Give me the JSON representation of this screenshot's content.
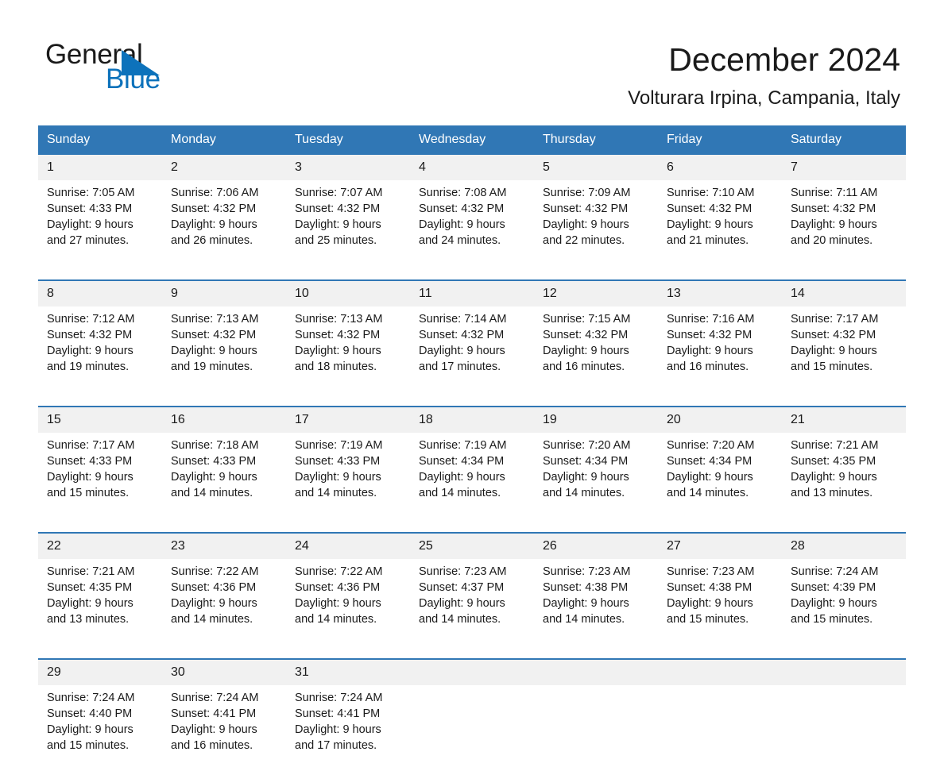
{
  "brand": {
    "name_part1": "General",
    "name_part2": "Blue",
    "triangle_color": "#0d72bb"
  },
  "header": {
    "title": "December 2024",
    "subtitle": "Volturara Irpina, Campania, Italy"
  },
  "colors": {
    "header_blue": "#3077b5",
    "daynum_band": "#f1f1f1",
    "text": "#1a1a1a",
    "brand_blue": "#0d72bb"
  },
  "weekdays": [
    "Sunday",
    "Monday",
    "Tuesday",
    "Wednesday",
    "Thursday",
    "Friday",
    "Saturday"
  ],
  "labels": {
    "sunrise_prefix": "Sunrise:",
    "sunset_prefix": "Sunset:",
    "daylight_prefix": "Daylight:"
  },
  "weeks": [
    [
      {
        "day": "1",
        "sunrise": "Sunrise: 7:05 AM",
        "sunset": "Sunset: 4:33 PM",
        "daylight_line1": "Daylight: 9 hours",
        "daylight_line2": "and 27 minutes."
      },
      {
        "day": "2",
        "sunrise": "Sunrise: 7:06 AM",
        "sunset": "Sunset: 4:32 PM",
        "daylight_line1": "Daylight: 9 hours",
        "daylight_line2": "and 26 minutes."
      },
      {
        "day": "3",
        "sunrise": "Sunrise: 7:07 AM",
        "sunset": "Sunset: 4:32 PM",
        "daylight_line1": "Daylight: 9 hours",
        "daylight_line2": "and 25 minutes."
      },
      {
        "day": "4",
        "sunrise": "Sunrise: 7:08 AM",
        "sunset": "Sunset: 4:32 PM",
        "daylight_line1": "Daylight: 9 hours",
        "daylight_line2": "and 24 minutes."
      },
      {
        "day": "5",
        "sunrise": "Sunrise: 7:09 AM",
        "sunset": "Sunset: 4:32 PM",
        "daylight_line1": "Daylight: 9 hours",
        "daylight_line2": "and 22 minutes."
      },
      {
        "day": "6",
        "sunrise": "Sunrise: 7:10 AM",
        "sunset": "Sunset: 4:32 PM",
        "daylight_line1": "Daylight: 9 hours",
        "daylight_line2": "and 21 minutes."
      },
      {
        "day": "7",
        "sunrise": "Sunrise: 7:11 AM",
        "sunset": "Sunset: 4:32 PM",
        "daylight_line1": "Daylight: 9 hours",
        "daylight_line2": "and 20 minutes."
      }
    ],
    [
      {
        "day": "8",
        "sunrise": "Sunrise: 7:12 AM",
        "sunset": "Sunset: 4:32 PM",
        "daylight_line1": "Daylight: 9 hours",
        "daylight_line2": "and 19 minutes."
      },
      {
        "day": "9",
        "sunrise": "Sunrise: 7:13 AM",
        "sunset": "Sunset: 4:32 PM",
        "daylight_line1": "Daylight: 9 hours",
        "daylight_line2": "and 19 minutes."
      },
      {
        "day": "10",
        "sunrise": "Sunrise: 7:13 AM",
        "sunset": "Sunset: 4:32 PM",
        "daylight_line1": "Daylight: 9 hours",
        "daylight_line2": "and 18 minutes."
      },
      {
        "day": "11",
        "sunrise": "Sunrise: 7:14 AM",
        "sunset": "Sunset: 4:32 PM",
        "daylight_line1": "Daylight: 9 hours",
        "daylight_line2": "and 17 minutes."
      },
      {
        "day": "12",
        "sunrise": "Sunrise: 7:15 AM",
        "sunset": "Sunset: 4:32 PM",
        "daylight_line1": "Daylight: 9 hours",
        "daylight_line2": "and 16 minutes."
      },
      {
        "day": "13",
        "sunrise": "Sunrise: 7:16 AM",
        "sunset": "Sunset: 4:32 PM",
        "daylight_line1": "Daylight: 9 hours",
        "daylight_line2": "and 16 minutes."
      },
      {
        "day": "14",
        "sunrise": "Sunrise: 7:17 AM",
        "sunset": "Sunset: 4:32 PM",
        "daylight_line1": "Daylight: 9 hours",
        "daylight_line2": "and 15 minutes."
      }
    ],
    [
      {
        "day": "15",
        "sunrise": "Sunrise: 7:17 AM",
        "sunset": "Sunset: 4:33 PM",
        "daylight_line1": "Daylight: 9 hours",
        "daylight_line2": "and 15 minutes."
      },
      {
        "day": "16",
        "sunrise": "Sunrise: 7:18 AM",
        "sunset": "Sunset: 4:33 PM",
        "daylight_line1": "Daylight: 9 hours",
        "daylight_line2": "and 14 minutes."
      },
      {
        "day": "17",
        "sunrise": "Sunrise: 7:19 AM",
        "sunset": "Sunset: 4:33 PM",
        "daylight_line1": "Daylight: 9 hours",
        "daylight_line2": "and 14 minutes."
      },
      {
        "day": "18",
        "sunrise": "Sunrise: 7:19 AM",
        "sunset": "Sunset: 4:34 PM",
        "daylight_line1": "Daylight: 9 hours",
        "daylight_line2": "and 14 minutes."
      },
      {
        "day": "19",
        "sunrise": "Sunrise: 7:20 AM",
        "sunset": "Sunset: 4:34 PM",
        "daylight_line1": "Daylight: 9 hours",
        "daylight_line2": "and 14 minutes."
      },
      {
        "day": "20",
        "sunrise": "Sunrise: 7:20 AM",
        "sunset": "Sunset: 4:34 PM",
        "daylight_line1": "Daylight: 9 hours",
        "daylight_line2": "and 14 minutes."
      },
      {
        "day": "21",
        "sunrise": "Sunrise: 7:21 AM",
        "sunset": "Sunset: 4:35 PM",
        "daylight_line1": "Daylight: 9 hours",
        "daylight_line2": "and 13 minutes."
      }
    ],
    [
      {
        "day": "22",
        "sunrise": "Sunrise: 7:21 AM",
        "sunset": "Sunset: 4:35 PM",
        "daylight_line1": "Daylight: 9 hours",
        "daylight_line2": "and 13 minutes."
      },
      {
        "day": "23",
        "sunrise": "Sunrise: 7:22 AM",
        "sunset": "Sunset: 4:36 PM",
        "daylight_line1": "Daylight: 9 hours",
        "daylight_line2": "and 14 minutes."
      },
      {
        "day": "24",
        "sunrise": "Sunrise: 7:22 AM",
        "sunset": "Sunset: 4:36 PM",
        "daylight_line1": "Daylight: 9 hours",
        "daylight_line2": "and 14 minutes."
      },
      {
        "day": "25",
        "sunrise": "Sunrise: 7:23 AM",
        "sunset": "Sunset: 4:37 PM",
        "daylight_line1": "Daylight: 9 hours",
        "daylight_line2": "and 14 minutes."
      },
      {
        "day": "26",
        "sunrise": "Sunrise: 7:23 AM",
        "sunset": "Sunset: 4:38 PM",
        "daylight_line1": "Daylight: 9 hours",
        "daylight_line2": "and 14 minutes."
      },
      {
        "day": "27",
        "sunrise": "Sunrise: 7:23 AM",
        "sunset": "Sunset: 4:38 PM",
        "daylight_line1": "Daylight: 9 hours",
        "daylight_line2": "and 15 minutes."
      },
      {
        "day": "28",
        "sunrise": "Sunrise: 7:24 AM",
        "sunset": "Sunset: 4:39 PM",
        "daylight_line1": "Daylight: 9 hours",
        "daylight_line2": "and 15 minutes."
      }
    ],
    [
      {
        "day": "29",
        "sunrise": "Sunrise: 7:24 AM",
        "sunset": "Sunset: 4:40 PM",
        "daylight_line1": "Daylight: 9 hours",
        "daylight_line2": "and 15 minutes."
      },
      {
        "day": "30",
        "sunrise": "Sunrise: 7:24 AM",
        "sunset": "Sunset: 4:41 PM",
        "daylight_line1": "Daylight: 9 hours",
        "daylight_line2": "and 16 minutes."
      },
      {
        "day": "31",
        "sunrise": "Sunrise: 7:24 AM",
        "sunset": "Sunset: 4:41 PM",
        "daylight_line1": "Daylight: 9 hours",
        "daylight_line2": "and 17 minutes."
      },
      {
        "day": "",
        "sunrise": "",
        "sunset": "",
        "daylight_line1": "",
        "daylight_line2": ""
      },
      {
        "day": "",
        "sunrise": "",
        "sunset": "",
        "daylight_line1": "",
        "daylight_line2": ""
      },
      {
        "day": "",
        "sunrise": "",
        "sunset": "",
        "daylight_line1": "",
        "daylight_line2": ""
      },
      {
        "day": "",
        "sunrise": "",
        "sunset": "",
        "daylight_line1": "",
        "daylight_line2": ""
      }
    ]
  ]
}
